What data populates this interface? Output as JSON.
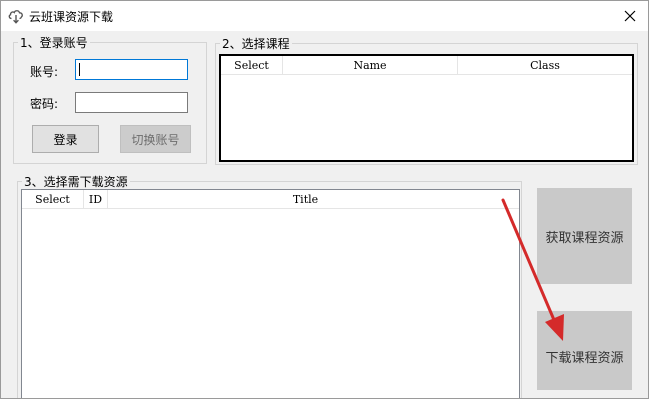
{
  "window": {
    "title": "云班课资源下载",
    "icon": "cloud-download-icon",
    "close_icon": "close-icon"
  },
  "login_group": {
    "legend": "1、登录账号",
    "account_label": "账号:",
    "account_value": "",
    "password_label": "密码:",
    "password_value": "",
    "login_button": "登录",
    "switch_account_button": "切换账号"
  },
  "course_group": {
    "legend": "2、选择课程",
    "columns": [
      "Select",
      "Name",
      "Class"
    ]
  },
  "resource_group": {
    "legend": "3、选择需下载资源",
    "columns": [
      "Select",
      "ID",
      "Title"
    ]
  },
  "actions": {
    "get_resources_button": "获取课程资源",
    "download_resources_button": "下载课程资源"
  },
  "annotation": {
    "arrow_color": "#d42a2a"
  },
  "colors": {
    "focus_border": "#0078d7",
    "big_button_bg": "#c9c9c9"
  }
}
